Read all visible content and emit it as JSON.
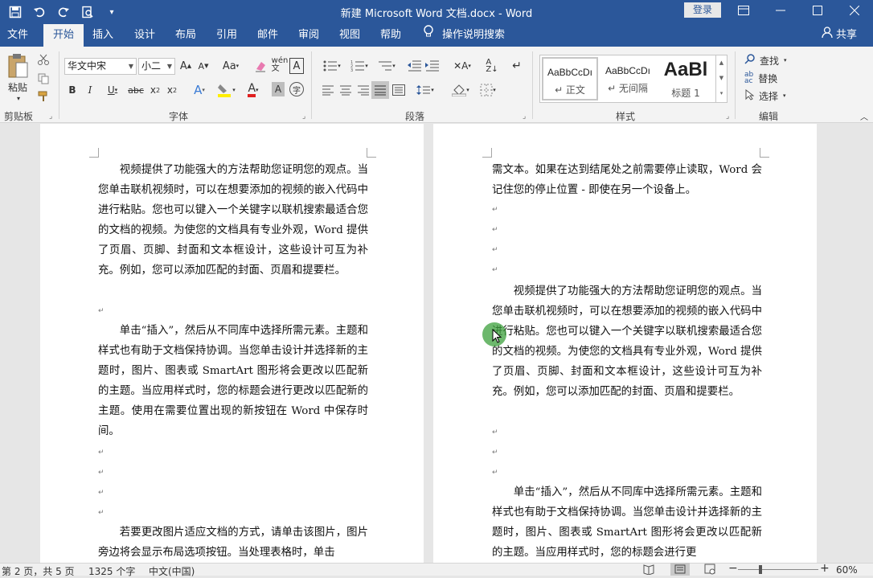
{
  "titlebar": {
    "title": "新建 Microsoft Word 文档.docx  -  Word",
    "login": "登录",
    "qat": [
      "save-icon",
      "undo-icon",
      "redo-icon",
      "print-preview-icon",
      "customize-icon"
    ]
  },
  "tabs": {
    "items": [
      "文件",
      "开始",
      "插入",
      "设计",
      "布局",
      "引用",
      "邮件",
      "审阅",
      "视图",
      "帮助"
    ],
    "active": "开始",
    "tell_me": "操作说明搜索",
    "share": "共享"
  },
  "ribbon": {
    "clipboard": {
      "paste": "粘贴",
      "label": "剪贴板"
    },
    "font": {
      "name": "华文中宋",
      "size": "小二",
      "label": "字体"
    },
    "paragraph": {
      "label": "段落"
    },
    "styles": {
      "label": "样式",
      "items": [
        {
          "preview": "AaBbCcDı",
          "name": "↵ 正文"
        },
        {
          "preview": "AaBbCcDı",
          "name": "↵ 无间隔"
        },
        {
          "preview": "AaBl",
          "name": "标题 1"
        }
      ]
    },
    "editing": {
      "find": "查找",
      "replace": "替换",
      "select": "选择",
      "label": "编辑"
    }
  },
  "document": {
    "left_page": {
      "p1": "视频提供了功能强大的方法帮助您证明您的观点。当您单击联机视频时，可以在想要添加的视频的嵌入代码中进行粘贴。您也可以键入一个关键字以联机搜索最适合您的文档的视频。为使您的文档具有专业外观，Word 提供了页眉、页脚、封面和文本框设计，这些设计可互为补充。例如，您可以添加匹配的封面、页眉和提要栏。",
      "p2": "单击“插入”，然后从不同库中选择所需元素。主题和样式也有助于文档保持协调。当您单击设计并选择新的主题时，图片、图表或 SmartArt 图形将会更改以匹配新的主题。当应用样式时，您的标题会进行更改以匹配新的主题。使用在需要位置出现的新按钮在 Word 中保存时间。",
      "p3": "若要更改图片适应文档的方式，请单击该图片，图片旁边将会显示布局选项按钮。当处理表格时，单击"
    },
    "right_page": {
      "p0": "需文本。如果在达到结尾处之前需要停止读取，Word 会记住您的停止位置 - 即使在另一个设备上。",
      "p1": "视频提供了功能强大的方法帮助您证明您的观点。当您单击联机视频时，可以在想要添加的视频的嵌入代码中进行粘贴。您也可以键入一个关键字以联机搜索最适合您的文档的视频。为使您的文档具有专业外观，Word 提供了页眉、页脚、封面和文本框设计，这些设计可互为补充。例如，您可以添加匹配的封面、页眉和提要栏。",
      "p2": "单击“插入”，然后从不同库中选择所需元素。主题和样式也有助于文档保持协调。当您单击设计并选择新的主题时，图片、图表或 SmartArt 图形将会更改以匹配新的主题。当应用样式时，您的标题会进行更"
    }
  },
  "status": {
    "page": "第 2 页，共 5 页",
    "words": "1325 个字",
    "lang": "中文(中国)",
    "zoom": "60%"
  }
}
